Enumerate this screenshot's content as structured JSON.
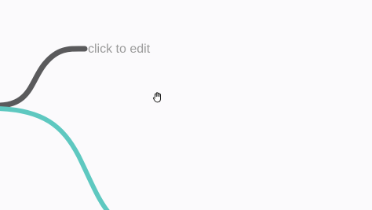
{
  "mindmap": {
    "node_placeholder": "click to edit"
  },
  "colors": {
    "background": "#fbfafc",
    "branch_dark": "#5a5a5c",
    "branch_teal": "#5ec8c0",
    "label_text": "#9a9a9a"
  },
  "cursor": {
    "icon": "hand-grab-icon"
  }
}
